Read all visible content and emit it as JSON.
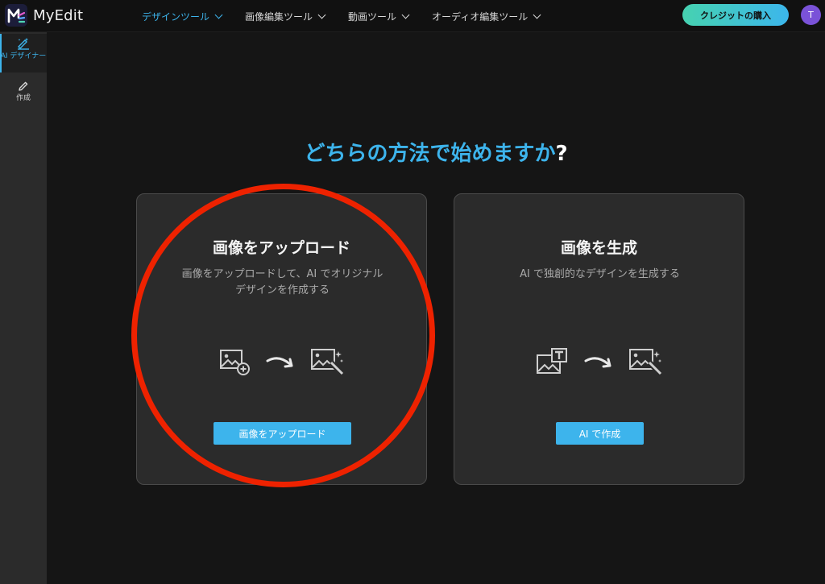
{
  "app": {
    "name": "MyEdit"
  },
  "nav": [
    {
      "label": "デザインツール",
      "active": true
    },
    {
      "label": "画像編集ツール",
      "active": false
    },
    {
      "label": "動画ツール",
      "active": false
    },
    {
      "label": "オーディオ編集ツール",
      "active": false
    }
  ],
  "header": {
    "credit_button": "クレジットの購入",
    "avatar_initial": "T"
  },
  "sidebar": {
    "items": [
      {
        "label": "AI デザイナー",
        "icon": "ai-design-icon",
        "active": true
      },
      {
        "label": "作成",
        "icon": "pencil-icon",
        "active": false
      }
    ]
  },
  "main": {
    "heading_highlight": "どちらの方法で始めますか",
    "heading_suffix": "?",
    "cards": [
      {
        "title": "画像をアップロード",
        "description_line1": "画像をアップロードして、AI でオリジナル",
        "description_line2": "デザインを作成する",
        "button": "画像をアップロード",
        "icons": [
          "image-add-icon",
          "curved-arrow-icon",
          "image-magic-icon"
        ]
      },
      {
        "title": "画像を生成",
        "description_line1": "AI で独創的なデザインを生成する",
        "button": "AI で作成",
        "icons": [
          "image-text-icon",
          "curved-arrow-icon",
          "image-magic-icon"
        ]
      }
    ]
  },
  "colors": {
    "accent": "#3db4ec",
    "annotation": "#ee2200",
    "card_bg": "#2b2b2b",
    "page_bg": "#151515"
  }
}
